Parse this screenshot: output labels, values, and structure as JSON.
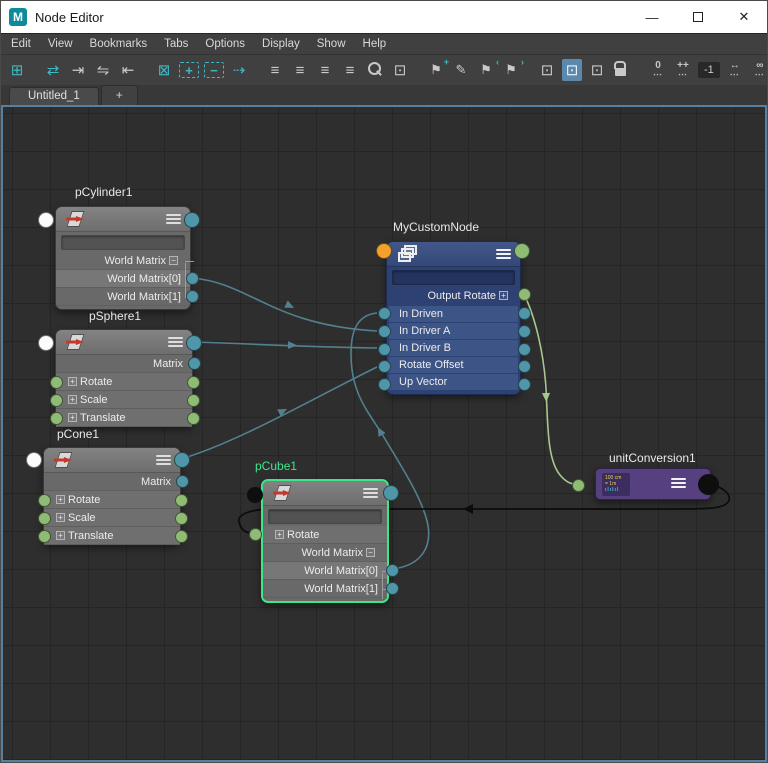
{
  "window": {
    "title": "Node Editor",
    "app_icon": "M",
    "controls": {
      "minimize": "—",
      "close": "✕"
    }
  },
  "menu": {
    "items": [
      "Edit",
      "View",
      "Bookmarks",
      "Tabs",
      "Options",
      "Display",
      "Show",
      "Help"
    ]
  },
  "toolbar": {
    "items": [
      {
        "name": "create-node",
        "glyph": "⊞"
      },
      {
        "name": "sync-selection",
        "glyph": "⇄"
      },
      {
        "name": "input-connections",
        "glyph": "⇥"
      },
      {
        "name": "input-output-connections",
        "glyph": "⇋"
      },
      {
        "name": "output-connections",
        "glyph": "⇤"
      },
      {
        "name": "frame-selection",
        "glyph": "⊠"
      },
      {
        "name": "add-selected-to-graph",
        "glyph": "+"
      },
      {
        "name": "remove-selected-from-graph",
        "glyph": "−"
      },
      {
        "name": "pin-flow",
        "glyph": "⇢"
      },
      {
        "name": "layout-simple",
        "glyph": "≡"
      },
      {
        "name": "layout-connected",
        "glyph": "≡"
      },
      {
        "name": "layout-all",
        "glyph": "≡"
      },
      {
        "name": "layout-custom",
        "glyph": "≡"
      },
      {
        "name": "select-in-scene",
        "glyph": "⊡"
      },
      {
        "name": "bookmark-add",
        "glyph": "⚑",
        "badge": "+"
      },
      {
        "name": "bookmark-edit",
        "glyph": "✎",
        "badge": ""
      },
      {
        "name": "bookmark-previous",
        "glyph": "⚑",
        "badge": "‹"
      },
      {
        "name": "bookmark-next",
        "glyph": "⚑",
        "badge": "›"
      },
      {
        "name": "display-simple-mode",
        "glyph": "⊡"
      },
      {
        "name": "display-connected-mode",
        "glyph": "⊡"
      },
      {
        "name": "display-all-mode",
        "glyph": "⊡"
      },
      {
        "name": "traversal-depth-zero",
        "label": "0",
        "dots": "⋯"
      },
      {
        "name": "traversal-depth-increase",
        "label": "++",
        "dots": "⋯"
      },
      {
        "name": "traversal-depth-value",
        "value": "-1"
      },
      {
        "name": "traversal-spread",
        "label": "↔",
        "dots": "⋯"
      },
      {
        "name": "traversal-unlimited",
        "label": "∞",
        "dots": "⋯"
      }
    ]
  },
  "tabs": {
    "active": "Untitled_1",
    "add_label": "+"
  },
  "graph": {
    "nodes": {
      "pCylinder1": {
        "title": "pCylinder1",
        "rows": [
          {
            "label": "World Matrix",
            "expand": "−"
          },
          {
            "label": "World Matrix[0]"
          },
          {
            "label": "World Matrix[1]"
          }
        ]
      },
      "pSphere1": {
        "title": "pSphere1",
        "rows": [
          {
            "label": "Matrix"
          },
          {
            "label": "Rotate",
            "expand": "+"
          },
          {
            "label": "Scale",
            "expand": "+"
          },
          {
            "label": "Translate",
            "expand": "+"
          }
        ]
      },
      "pCone1": {
        "title": "pCone1",
        "rows": [
          {
            "label": "Matrix"
          },
          {
            "label": "Rotate",
            "expand": "+"
          },
          {
            "label": "Scale",
            "expand": "+"
          },
          {
            "label": "Translate",
            "expand": "+"
          }
        ]
      },
      "pCube1": {
        "title": "pCube1",
        "selected": true,
        "rows": [
          {
            "label": "Rotate",
            "expand": "+"
          },
          {
            "label": "World Matrix",
            "expand": "−"
          },
          {
            "label": "World Matrix[0]"
          },
          {
            "label": "World Matrix[1]"
          }
        ]
      },
      "myCustomNode": {
        "title": "MyCustomNode",
        "rows": [
          {
            "label": "Output Rotate",
            "expand": "+"
          },
          {
            "label": "In Driven"
          },
          {
            "label": "In Driver A"
          },
          {
            "label": "In Driver B"
          },
          {
            "label": "Rotate Offset"
          },
          {
            "label": "Up Vector"
          }
        ]
      },
      "unitConversion1": {
        "title": "unitConversion1",
        "icon_lines": {
          "l1": "100 cm",
          "l2": "= 1m",
          "l3": "ılılıl"
        }
      }
    },
    "connections": [
      {
        "from": "pCylinder1.worldMatrix[0]",
        "to": "MyCustomNode.inDriverA"
      },
      {
        "from": "pSphere1.message",
        "to": "MyCustomNode.inDriverB"
      },
      {
        "from": "pCone1.message",
        "to": "MyCustomNode.rotateOffset"
      },
      {
        "from": "pCube1.worldMatrix[0]",
        "to": "MyCustomNode.inDriven"
      },
      {
        "from": "MyCustomNode.outputRotate",
        "to": "unitConversion1.input"
      },
      {
        "from": "unitConversion1.output",
        "to": "pCube1.rotate"
      }
    ],
    "colors": {
      "selection": "#3ee68a",
      "wire_teal": "#53808f",
      "wire_green": "#a8c78e",
      "wire_black": "#0c0c0c",
      "port_teal": "#4e96a8",
      "port_green": "#8fbc74",
      "port_orange": "#f2a22b",
      "node_blue": "#2e4173",
      "node_purple": "#57407f"
    }
  }
}
